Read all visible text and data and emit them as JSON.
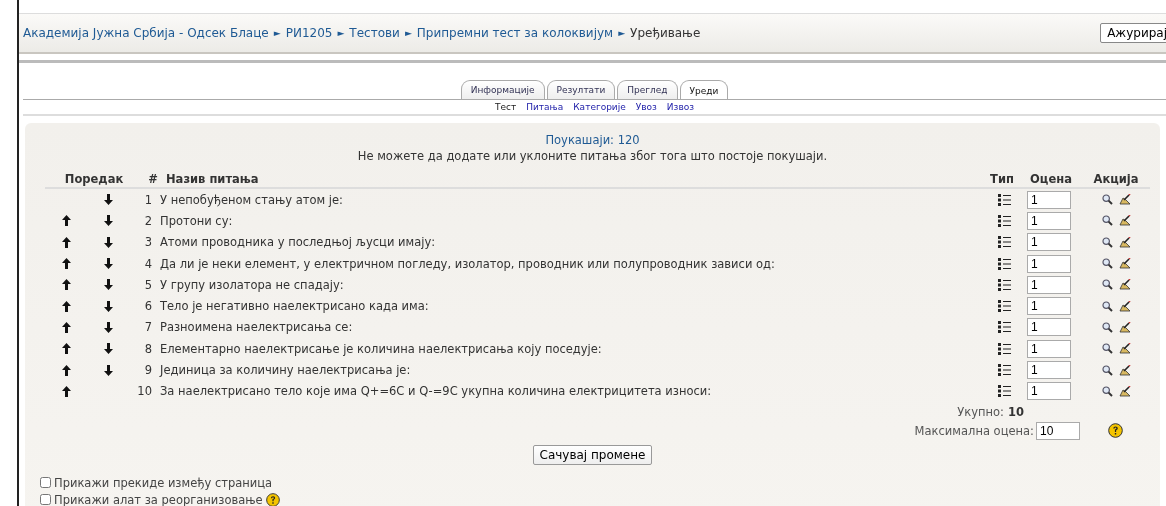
{
  "breadcrumb": [
    {
      "text": "Академија Јужна Србија - Одсек Блаце",
      "kind": "link"
    },
    {
      "text": "►",
      "kind": "separator"
    },
    {
      "text": "РИ1205",
      "kind": "link"
    },
    {
      "text": "►",
      "kind": "separator"
    },
    {
      "text": "Тестови",
      "kind": "link"
    },
    {
      "text": "►",
      "kind": "separator"
    },
    {
      "text": "Припремни тест за колоквијум",
      "kind": "link"
    },
    {
      "text": "►",
      "kind": "separator"
    },
    {
      "text": "Уређивање",
      "kind": "current"
    }
  ],
  "update_button": "Ажурирај",
  "tabs": [
    {
      "label": "Информације",
      "selected": false
    },
    {
      "label": "Резултати",
      "selected": false
    },
    {
      "label": "Преглед",
      "selected": false
    },
    {
      "label": "Уреди",
      "selected": true
    }
  ],
  "subtabs": [
    {
      "label": "Тест",
      "selected": true
    },
    {
      "label": "Питања",
      "selected": false
    },
    {
      "label": "Категорије",
      "selected": false
    },
    {
      "label": "Увоз",
      "selected": false
    },
    {
      "label": "Извоз",
      "selected": false
    }
  ],
  "attempts_link": "Поукашаји: 120",
  "notice": "Не можете да додате или уклоните питања због тога што постоје покушаји.",
  "table": {
    "columns": [
      "Поредак",
      "#",
      "Назив питања",
      "Тип",
      "Оцена",
      "Акција"
    ],
    "rows": [
      {
        "up": false,
        "down": true,
        "number": "1",
        "name": "У непобуђеном стању атом је:",
        "grade": "1"
      },
      {
        "up": true,
        "down": true,
        "number": "2",
        "name": "Протони су:",
        "grade": "1"
      },
      {
        "up": true,
        "down": true,
        "number": "3",
        "name": "Атоми проводника у последњој љусци имају:",
        "grade": "1"
      },
      {
        "up": true,
        "down": true,
        "number": "4",
        "name": "Да ли је неки елемент, у електричном погледу, изолатор, проводник или полупроводник зависи од:",
        "grade": "1"
      },
      {
        "up": true,
        "down": true,
        "number": "5",
        "name": "У групу изолатора не спадају:",
        "grade": "1"
      },
      {
        "up": true,
        "down": true,
        "number": "6",
        "name": "Тело је негативно наелектрисано када има:",
        "grade": "1"
      },
      {
        "up": true,
        "down": true,
        "number": "7",
        "name": "Разноимена наелектрисања се:",
        "grade": "1"
      },
      {
        "up": true,
        "down": true,
        "number": "8",
        "name": "Елементарно наелектрисање је количина наелектрисања коју поседује:",
        "grade": "1"
      },
      {
        "up": true,
        "down": true,
        "number": "9",
        "name": "Јединица за количину наелектрисања је:",
        "grade": "1"
      },
      {
        "up": true,
        "down": false,
        "number": "10",
        "name": "За наелектрисано тело које има Q+=6C и Q-=9C укупна количина електрицитета износи:",
        "grade": "1"
      }
    ]
  },
  "total_label": "Укупно:",
  "total_value": "10",
  "max_grade_label": "Максимална оцена:",
  "max_grade_value": "10",
  "save_button": "Сачувај промене",
  "options": [
    {
      "label": "Прикажи прекиде између страница",
      "checked": false,
      "help": false
    },
    {
      "label": "Прикажи алат за реорганизовање",
      "checked": false,
      "help": true
    }
  ]
}
